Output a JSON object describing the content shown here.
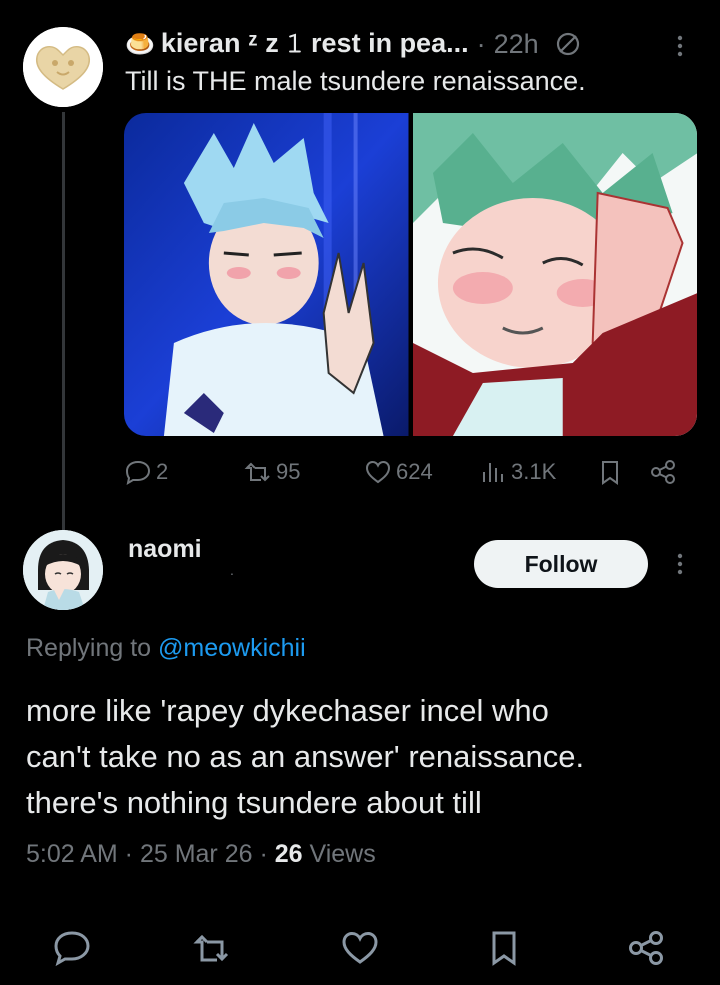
{
  "parent_tweet": {
    "avatar_icon": "heart-face-avatar",
    "emoji": "🍮",
    "display_name": "kieran ᶻ z 𝟷 rest in pea...",
    "separator": "·",
    "time": "22h",
    "status_icon": "ghost-icon",
    "text": "Till is THE male tsundere renaissance.",
    "actions": {
      "replies": "2",
      "reposts": "95",
      "likes": "624",
      "views": "3.1K"
    }
  },
  "reply": {
    "display_name": "naomi",
    "name_dot": ".",
    "follow_label": "Follow",
    "replying_prefix": "Replying to ",
    "replying_handle": "@meowkichii",
    "text_lines": [
      "more like 'rapey dykechaser incel who",
      "can't take no as an answer' renaissance.",
      "there's nothing tsundere about till"
    ],
    "meta": {
      "time": "5:02 AM",
      "sep1": " · ",
      "date": "25 Mar 26",
      "sep2": " · ",
      "views_count": "26",
      "views_label": " Views"
    }
  },
  "colors": {
    "background": "#000000",
    "text": "#e7e9ea",
    "muted": "#71767b",
    "link": "#1d9bf0",
    "follow_bg": "#eff3f4"
  }
}
